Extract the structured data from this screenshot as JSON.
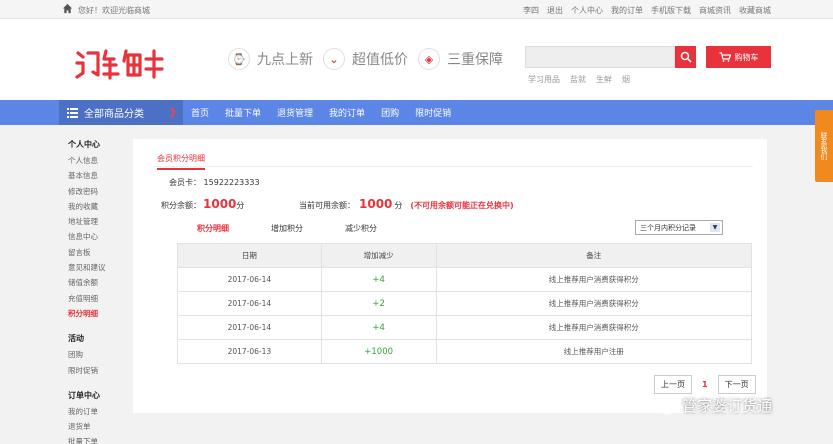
{
  "topbar": {
    "welcome": "您好！欢迎光临商城",
    "links": [
      "李四",
      "退出",
      "个人中心",
      "我的订单",
      "手机版下载",
      "商城资讯",
      "收藏商城"
    ]
  },
  "header": {
    "promos": [
      {
        "icon": "clock-icon",
        "label": "九点上新"
      },
      {
        "icon": "down-arrow-icon",
        "label": "超值低价"
      },
      {
        "icon": "shield-icon",
        "label": "三重保障"
      }
    ],
    "search": {
      "placeholder": ""
    },
    "cart_label": "购物车",
    "hotwords": [
      "学习用品",
      "盐就",
      "生鲜",
      "烟"
    ]
  },
  "nav": {
    "all_categories": "全部商品分类",
    "items": [
      "首页",
      "批量下单",
      "退货管理",
      "我的订单",
      "团购",
      "限时促销"
    ]
  },
  "sidebar": {
    "personal_title": "个人中心",
    "personal_items": [
      "个人信息",
      "基本信息",
      "修改密码",
      "我的收藏",
      "地址管理",
      "信息中心",
      "留言板",
      "意见和建议",
      "储值余额",
      "充值明细",
      "积分明细"
    ],
    "activity_title": "活动",
    "activity_items": [
      "团购",
      "限时促销"
    ],
    "order_title": "订单中心",
    "order_items": [
      "我的订单",
      "退货单",
      "批量下单"
    ]
  },
  "panel": {
    "tab": "会员积分明细",
    "member_label": "会员卡：",
    "member_no": "15922223333",
    "balance_label": "积分余额：",
    "balance_value": "1000",
    "unit": "分",
    "avail_label": "当前可用余额：",
    "avail_value": "1000",
    "avail_note": "(不可用余额可能正在兑换中)",
    "subtabs": [
      "积分明细",
      "增加积分",
      "减少积分"
    ],
    "range_select": "三个月内积分记录",
    "table": {
      "headers": [
        "日期",
        "增加减少",
        "备注"
      ],
      "rows": [
        {
          "date": "2017-06-14",
          "change": "+4",
          "note": "线上推荐用户消费获得积分"
        },
        {
          "date": "2017-06-14",
          "change": "+2",
          "note": "线上推荐用户消费获得积分"
        },
        {
          "date": "2017-06-14",
          "change": "+4",
          "note": "线上推荐用户消费获得积分"
        },
        {
          "date": "2017-06-13",
          "change": "+1000",
          "note": "线上推荐用户注册"
        }
      ]
    },
    "pager": {
      "prev": "上一页",
      "current": "1",
      "next": "下一页"
    }
  },
  "contact": "联系我们",
  "watermark": "管家婆订货通",
  "colors": {
    "accent": "#e8323c",
    "nav": "#5b86e5",
    "nav_dark": "#4c70c4"
  }
}
